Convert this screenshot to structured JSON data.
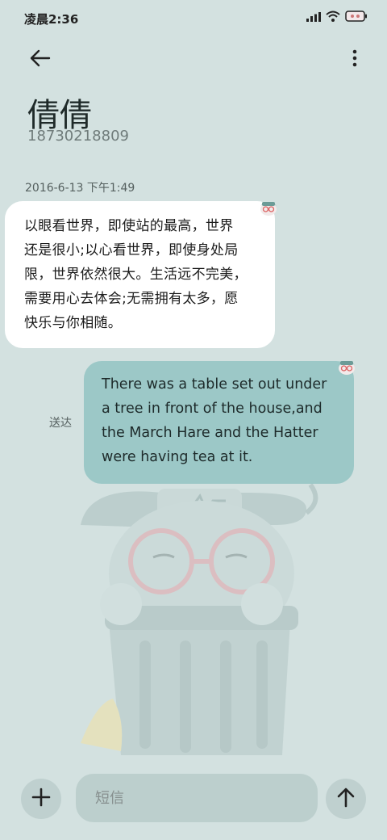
{
  "status_bar": {
    "time": "凌晨2:36",
    "icons": [
      "signal-icon",
      "wifi-icon",
      "battery-icon"
    ]
  },
  "header": {
    "back_icon": "arrow-left-icon",
    "more_icon": "more-vertical-icon",
    "contact_name": "倩倩",
    "contact_number": "18730218809"
  },
  "conversation": {
    "timestamp": "2016-6-13 下午1:49",
    "incoming": {
      "lines": [
        "以眼看世界，即使站的最高，世界",
        "还是很小;以心看世界，即使身处局",
        "限，世界依然很大。生活远不完美，",
        "需要用心去体会;无需拥有太多，愿",
        "快乐与你相随。"
      ]
    },
    "outgoing": {
      "lines": [
        "There was a table set out under",
        "a tree in front of the house,and",
        "the March Hare and the Hatter",
        "were having tea at it."
      ],
      "status": "送达"
    }
  },
  "composer": {
    "add_icon": "plus-icon",
    "placeholder": "短信",
    "send_icon": "arrow-up-icon"
  },
  "colors": {
    "background": "#d3e1e0",
    "incoming_bubble": "#ffffff",
    "outgoing_bubble": "#9cc8c7"
  }
}
